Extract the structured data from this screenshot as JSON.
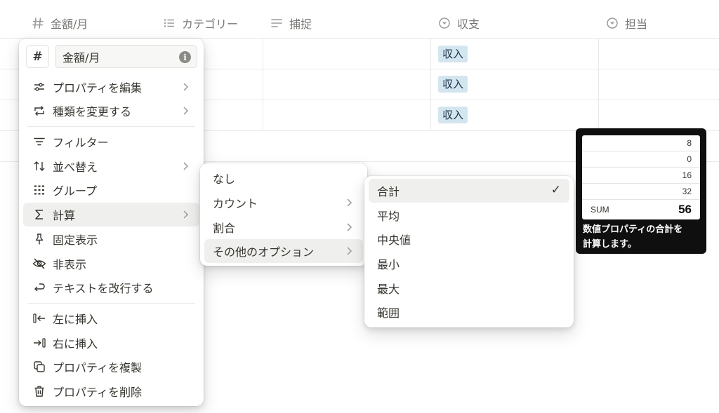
{
  "table": {
    "columns": [
      {
        "label": "金額/月",
        "icon": "number-icon"
      },
      {
        "label": "カテゴリー",
        "icon": "list-icon"
      },
      {
        "label": "捕捉",
        "icon": "text-icon"
      },
      {
        "label": "収支",
        "icon": "select-icon"
      },
      {
        "label": "担当",
        "icon": "select-icon"
      }
    ],
    "rows": [
      {
        "income": "収入"
      },
      {
        "income": "収入"
      },
      {
        "income": "収入"
      }
    ]
  },
  "property_menu": {
    "type_symbol": "#",
    "name_value": "金額/月",
    "items": [
      {
        "label": "プロパティを編集",
        "icon": "sliders-icon"
      },
      {
        "label": "種類を変更する",
        "icon": "change-type-icon"
      },
      {
        "label": "フィルター",
        "icon": "filter-icon"
      },
      {
        "label": "並べ替え",
        "icon": "sort-icon"
      },
      {
        "label": "グループ",
        "icon": "group-icon"
      },
      {
        "label": "計算",
        "icon": "sigma-icon"
      },
      {
        "label": "固定表示",
        "icon": "pin-icon"
      },
      {
        "label": "非表示",
        "icon": "eye-off-icon"
      },
      {
        "label": "テキストを改行する",
        "icon": "wrap-icon"
      },
      {
        "label": "左に挿入",
        "icon": "insert-left-icon"
      },
      {
        "label": "右に挿入",
        "icon": "insert-right-icon"
      },
      {
        "label": "プロパティを複製",
        "icon": "duplicate-icon"
      },
      {
        "label": "プロパティを削除",
        "icon": "trash-icon"
      }
    ]
  },
  "calc_menu": {
    "items": [
      {
        "label": "なし"
      },
      {
        "label": "カウント"
      },
      {
        "label": "割合"
      },
      {
        "label": "その他のオプション"
      }
    ]
  },
  "options_menu": {
    "items": [
      {
        "label": "合計"
      },
      {
        "label": "平均"
      },
      {
        "label": "中央値"
      },
      {
        "label": "最小"
      },
      {
        "label": "最大"
      },
      {
        "label": "範囲"
      }
    ],
    "selected_mark": "✓"
  },
  "tooltip": {
    "values": [
      "8",
      "0",
      "16",
      "32"
    ],
    "sum_label": "SUM",
    "sum_value": "56",
    "description_line1": "数値プロパティの合計を",
    "description_line2": "計算します。"
  },
  "colors": {
    "tag_bg": "#d3e5ef",
    "tag_text": "#183347",
    "hover_bg": "#efefed",
    "tooltip_bg": "#0f0f0f"
  }
}
